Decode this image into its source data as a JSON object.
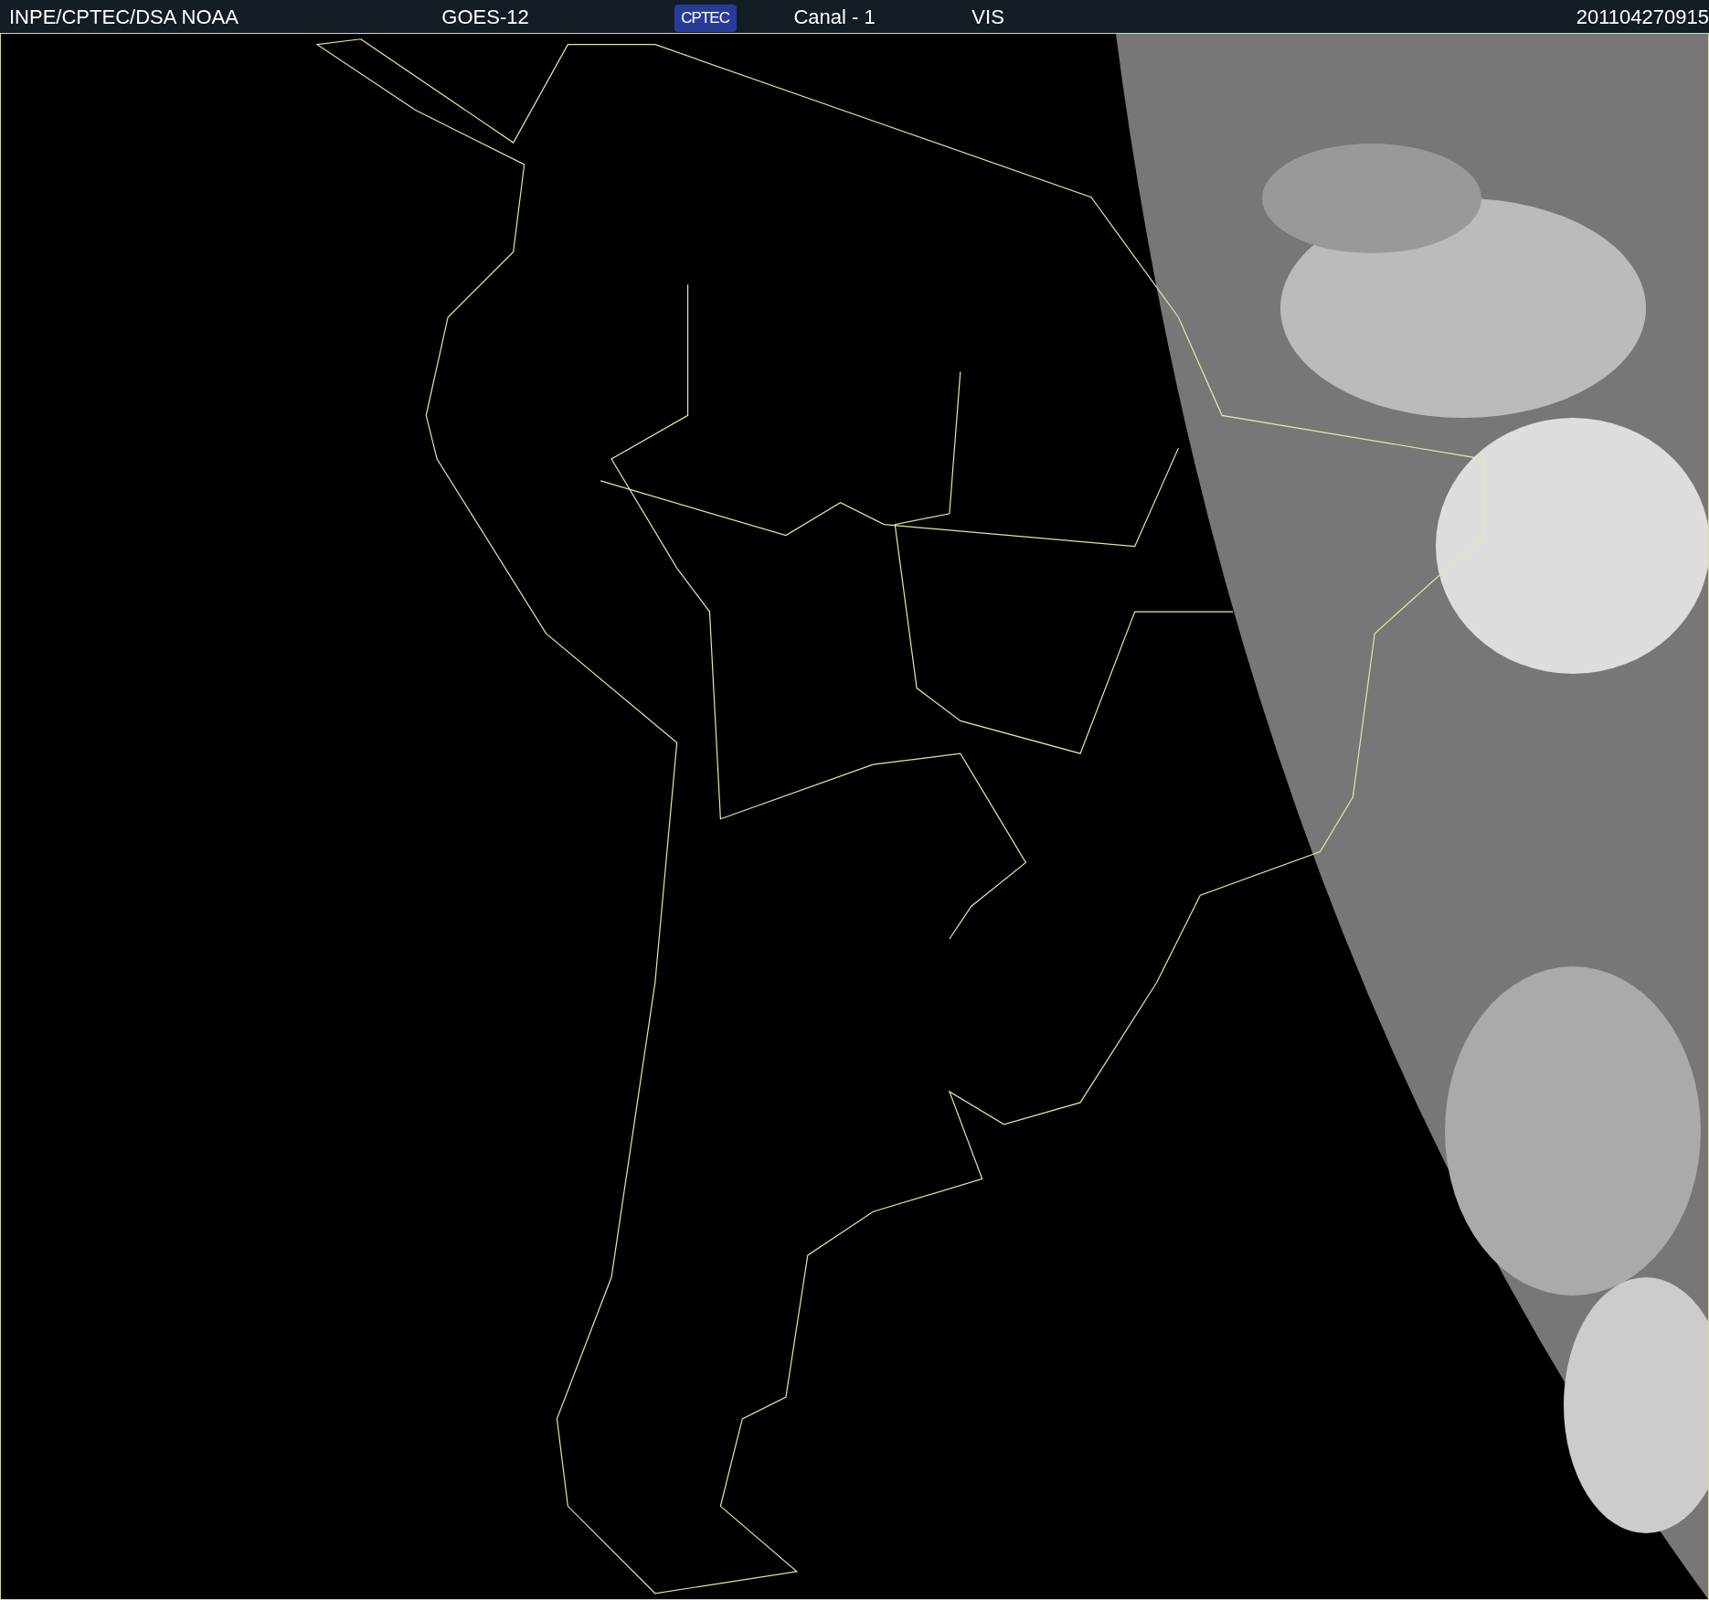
{
  "header": {
    "items": [
      {
        "kind": "text",
        "text": "INPE/CPTEC/DSA"
      },
      {
        "kind": "text",
        "text": "NOAA"
      },
      {
        "kind": "text",
        "text": "GOES-12"
      },
      {
        "kind": "logo",
        "text": "CPTEC"
      },
      {
        "kind": "text",
        "text": "Canal - 1"
      },
      {
        "kind": "text",
        "text": "VIS"
      },
      {
        "kind": "text",
        "text": "201104270915"
      }
    ]
  }
}
